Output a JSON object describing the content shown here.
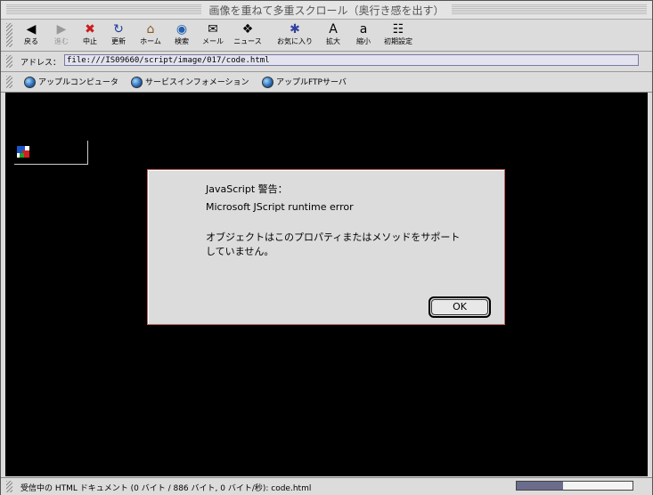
{
  "window": {
    "title": "画像を重ねて多重スクロール（奥行き感を出す）"
  },
  "toolbar": {
    "buttons": [
      {
        "label": "戻る",
        "icon": "back-arrow-icon",
        "glyph": "◀",
        "enabled": true
      },
      {
        "label": "進む",
        "icon": "forward-arrow-icon",
        "glyph": "▶",
        "enabled": false
      },
      {
        "label": "中止",
        "icon": "stop-icon",
        "glyph": "✖",
        "enabled": true
      },
      {
        "label": "更新",
        "icon": "refresh-icon",
        "glyph": "↻",
        "enabled": true
      },
      {
        "label": "ホーム",
        "icon": "home-icon",
        "glyph": "⌂",
        "enabled": true
      },
      {
        "label": "検索",
        "icon": "search-icon",
        "glyph": "◉",
        "enabled": true
      },
      {
        "label": "メール",
        "icon": "mail-icon",
        "glyph": "✉",
        "enabled": true
      },
      {
        "label": "ニュース",
        "icon": "news-icon",
        "glyph": "❖",
        "enabled": true
      },
      {
        "label": "お気に入り",
        "icon": "favorites-icon",
        "glyph": "✱",
        "enabled": true
      },
      {
        "label": "拡大",
        "icon": "larger-font-icon",
        "glyph": "A",
        "enabled": true
      },
      {
        "label": "縮小",
        "icon": "smaller-font-icon",
        "glyph": "a",
        "enabled": true
      },
      {
        "label": "初期設定",
        "icon": "preferences-icon",
        "glyph": "☷",
        "enabled": true
      }
    ]
  },
  "address": {
    "label": "アドレス：",
    "value": "file:///IS09660/script/image/017/code.html"
  },
  "favorites": [
    {
      "label": "アップルコンピュータ"
    },
    {
      "label": "サービスインフォメーション"
    },
    {
      "label": "アップルFTPサーバ"
    }
  ],
  "dialog": {
    "title": "JavaScript 警告：",
    "line1": "Microsoft JScript runtime error",
    "line2": "オブジェクトはこのプロパティまたはメソッドをサポート",
    "line3": "していません。",
    "ok_label": "OK"
  },
  "status": {
    "text": "受信中の HTML ドキュメント (0 バイト / 886 バイト, 0 バイト/秒): code.html",
    "progress": 0.4
  },
  "colors": {
    "content_bg": "#000000",
    "dialog_border": "#c06060",
    "progress_fill": "#6b6b8c"
  }
}
